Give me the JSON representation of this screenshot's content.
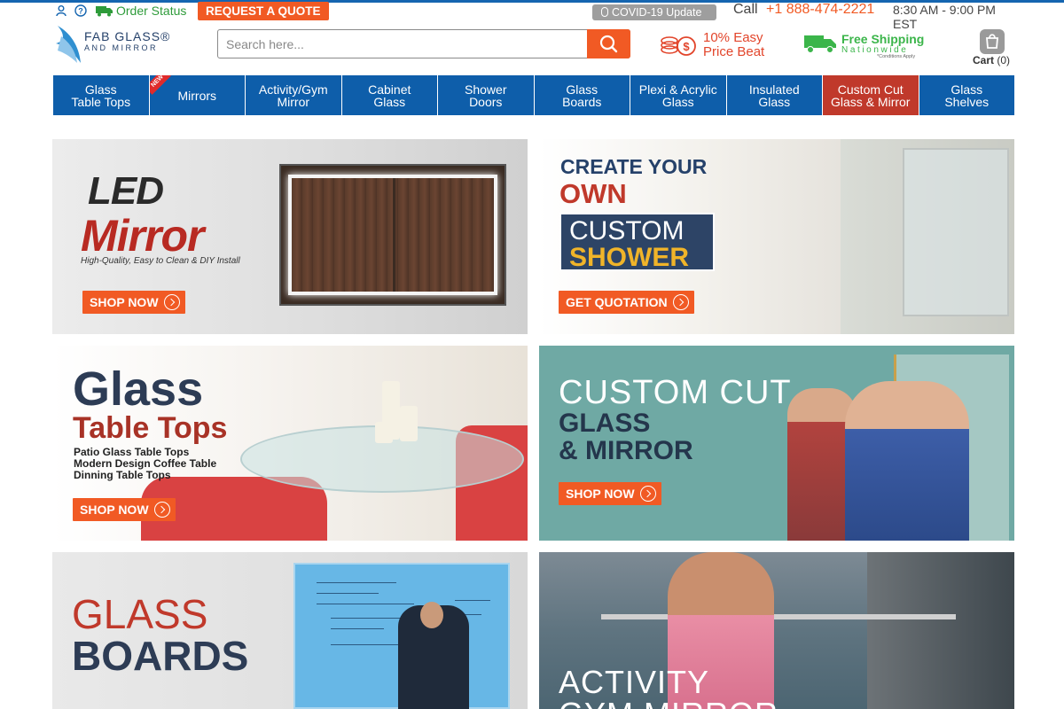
{
  "topbar": {
    "order_status": "Order Status",
    "quote_button": "REQUEST A QUOTE",
    "covid_label": "COVID-19 Update",
    "call_label": "Call",
    "phone": "+1 888-474-2221",
    "hours": "8:30 AM - 9:00 PM EST",
    "icons": [
      "user-icon",
      "help-icon",
      "truck-icon",
      "microphone-icon"
    ]
  },
  "header": {
    "logo_line1": "FAB GLASS®",
    "logo_line2": "AND MIRROR",
    "search_placeholder": "Search here...",
    "price_beat_line1": "10% Easy",
    "price_beat_line2": "Price Beat",
    "shipping_line1": "Free Shipping",
    "shipping_line2": "Nationwide",
    "shipping_note": "*Conditions Apply",
    "cart_label": "Cart",
    "cart_count": "(0)"
  },
  "nav": {
    "items": [
      {
        "line1": "Glass",
        "line2": "Table Tops"
      },
      {
        "line1": "Mirrors",
        "line2": "",
        "badge": "NEW"
      },
      {
        "line1": "Activity/Gym",
        "line2": "Mirror"
      },
      {
        "line1": "Cabinet",
        "line2": "Glass"
      },
      {
        "line1": "Shower",
        "line2": "Doors"
      },
      {
        "line1": "Glass",
        "line2": "Boards"
      },
      {
        "line1": "Plexi & Acrylic",
        "line2": "Glass"
      },
      {
        "line1": "Insulated",
        "line2": "Glass"
      },
      {
        "line1": "Custom Cut",
        "line2": "Glass & Mirror",
        "highlighted": true
      },
      {
        "line1": "Glass",
        "line2": "Shelves"
      }
    ]
  },
  "banners": {
    "led": {
      "title1": "LED",
      "title2": "Mirror",
      "subtitle": "High-Quality, Easy to Clean & DIY Install",
      "cta": "SHOP NOW"
    },
    "shower": {
      "title1": "CREATE YOUR",
      "title2": "OWN",
      "title3": "CUSTOM",
      "title4": "SHOWER",
      "cta": "GET QUOTATION"
    },
    "table": {
      "title1": "Glass",
      "title2": "Table Tops",
      "items": [
        "Patio Glass Table Tops",
        "Modern Design Coffee Table",
        "Dinning Table Tops"
      ],
      "cta": "SHOP NOW"
    },
    "custom": {
      "title1": "CUSTOM CUT",
      "title2": "GLASS",
      "title3": "& MIRROR",
      "cta": "SHOP NOW"
    },
    "boards": {
      "title1": "GLASS",
      "title2": "BOARDS"
    },
    "gym": {
      "title1": "ACTIVITY",
      "title2": "GYM MIRROR"
    }
  },
  "colors": {
    "accent": "#f15a24",
    "nav": "#0e5eaa",
    "nav_highlight": "#c0392b",
    "green": "#2e9b3a"
  }
}
